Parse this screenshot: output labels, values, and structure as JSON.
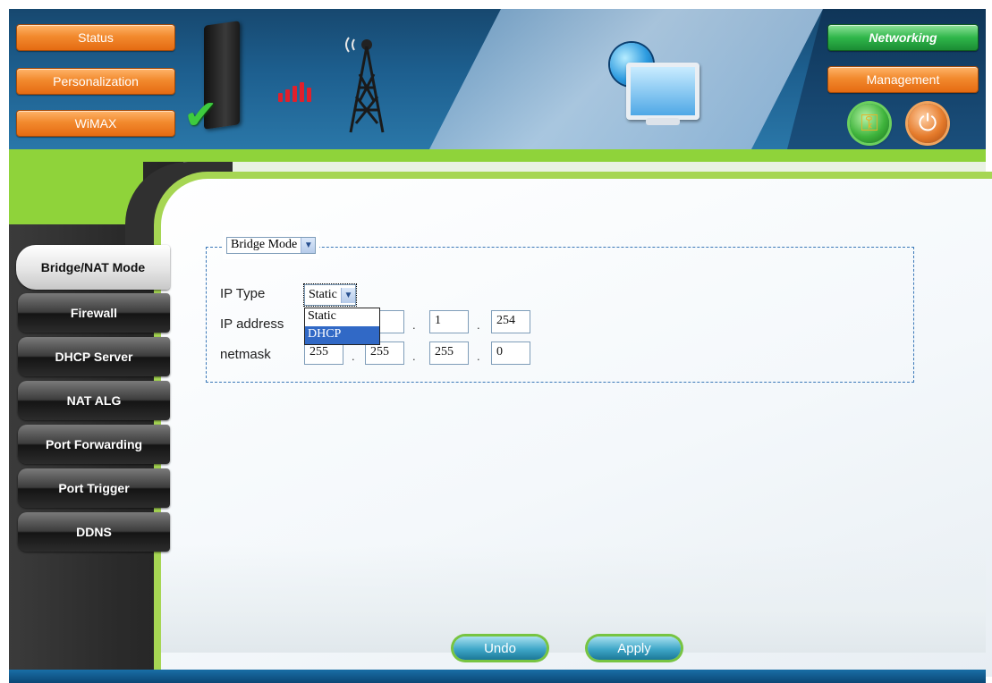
{
  "header": {
    "left_nav": [
      {
        "label": "Status"
      },
      {
        "label": "Personalization"
      },
      {
        "label": "WiMAX"
      }
    ],
    "right_nav": [
      {
        "label": "Networking",
        "active": true
      },
      {
        "label": "Management",
        "active": false
      }
    ],
    "icons": [
      "router-device-icon",
      "check-icon",
      "signal-strength-icon",
      "cell-tower-icon",
      "globe-icon",
      "monitor-icon",
      "key-icon",
      "power-icon"
    ]
  },
  "sidebar": {
    "items": [
      {
        "label": "Bridge/NAT Mode",
        "active": true
      },
      {
        "label": "Firewall"
      },
      {
        "label": "DHCP Server"
      },
      {
        "label": "NAT ALG"
      },
      {
        "label": "Port Forwarding"
      },
      {
        "label": "Port Trigger"
      },
      {
        "label": "DDNS"
      }
    ]
  },
  "form": {
    "mode_select": {
      "value": "Bridge Mode"
    },
    "ip_type": {
      "label": "IP Type",
      "value": "Static",
      "options": [
        "Static",
        "DHCP"
      ],
      "highlighted": "DHCP"
    },
    "ip_address": {
      "label": "IP address",
      "octets": [
        "",
        "",
        "1",
        "254"
      ]
    },
    "netmask": {
      "label": "netmask",
      "octets": [
        "255",
        "255",
        "255",
        "0"
      ]
    },
    "separator": "."
  },
  "buttons": {
    "undo": "Undo",
    "apply": "Apply"
  },
  "colors": {
    "nav_orange": "#f28a2e",
    "nav_green": "#2fb64a",
    "accent_green": "#8fd33a",
    "banner_blue": "#1d5f8f",
    "highlight": "#3169c6"
  }
}
